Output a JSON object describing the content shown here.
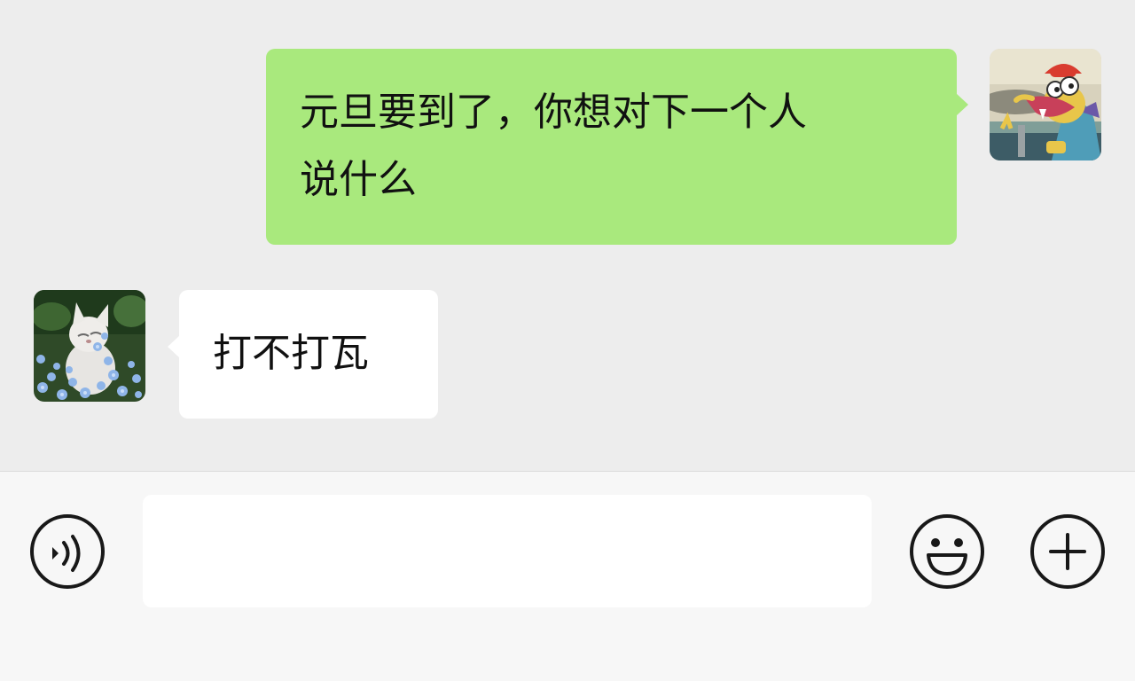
{
  "chat": {
    "messages": [
      {
        "sender": "me",
        "text": "元旦要到了，你想对下一个人说什么",
        "lines": [
          "元旦要到了，你想对下一个人",
          "说什么"
        ],
        "bubble_color": "#a9e97d"
      },
      {
        "sender": "friend",
        "text": "打不打瓦",
        "bubble_color": "#ffffff"
      }
    ],
    "avatars": {
      "me": "cartoon-fish-avatar",
      "friend": "white-kitten-flowers-avatar"
    }
  },
  "input_bar": {
    "voice_icon": "voice-icon",
    "input_value": "",
    "input_placeholder": "",
    "emoji_icon": "emoji-smile-icon",
    "more_icon": "plus-icon"
  },
  "colors": {
    "chat_background": "#ededed",
    "input_bar_background": "#f7f7f7",
    "sent_bubble": "#a9e97d",
    "received_bubble": "#ffffff",
    "icon_stroke": "#181818"
  }
}
